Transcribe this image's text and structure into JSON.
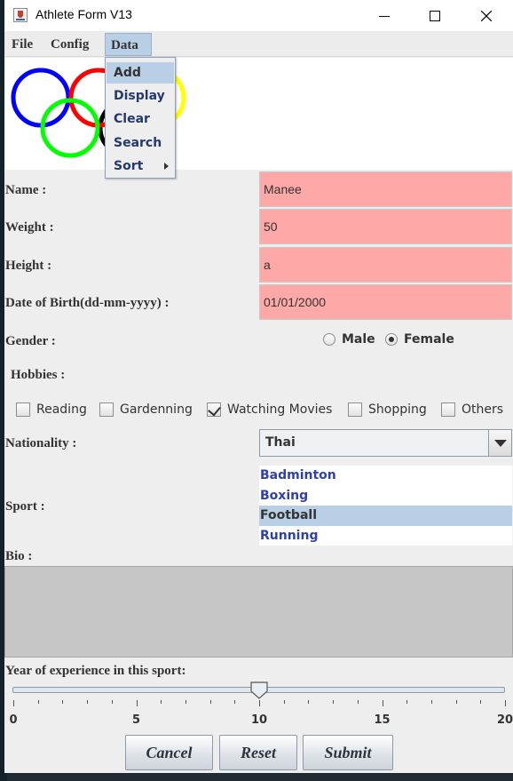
{
  "window": {
    "title": "Athlete Form V13"
  },
  "menubar": {
    "file": "File",
    "config": "Config",
    "data": "Data"
  },
  "data_menu": {
    "items": [
      "Add",
      "Display",
      "Clear",
      "Search",
      "Sort"
    ],
    "highlighted": "Add"
  },
  "form": {
    "name_label": "Name :",
    "name_value": "Manee",
    "weight_label": "Weight :",
    "weight_value": "50",
    "height_label": "Height :",
    "height_value": "a",
    "dob_label": "Date of Birth(dd-mm-yyyy) :",
    "dob_value": "01/01/2000",
    "gender_label": "Gender :",
    "gender_options": [
      "Male",
      "Female"
    ],
    "gender_selected": "Female",
    "hobbies_label": "Hobbies :",
    "hobbies": [
      {
        "label": "Reading",
        "checked": false
      },
      {
        "label": "Gardenning",
        "checked": false
      },
      {
        "label": "Watching Movies",
        "checked": true
      },
      {
        "label": "Shopping",
        "checked": false
      },
      {
        "label": "Others",
        "checked": false
      }
    ],
    "nationality_label": "Nationality :",
    "nationality_value": "Thai",
    "sport_label": "Sport :",
    "sports": [
      "Badminton",
      "Boxing",
      "Football",
      "Running"
    ],
    "sport_selected": "Football",
    "bio_label": "Bio :",
    "bio_value": "",
    "experience_label": "Year of experience in this sport:",
    "experience_value": 10,
    "experience_min": 0,
    "experience_max": 20,
    "experience_tick_labels": [
      "0",
      "5",
      "10",
      "15",
      "20"
    ]
  },
  "buttons": {
    "cancel": "Cancel",
    "reset": "Reset",
    "submit": "Submit"
  },
  "colors": {
    "invalid_field": "#ffa8a8",
    "selection": "#b8cfe5",
    "list_text": "#2f3fb0",
    "ring_blue": "#0000ff",
    "ring_yellow": "#ffff00",
    "ring_black": "#000000",
    "ring_green": "#00ff00",
    "ring_red": "#ff0000"
  }
}
